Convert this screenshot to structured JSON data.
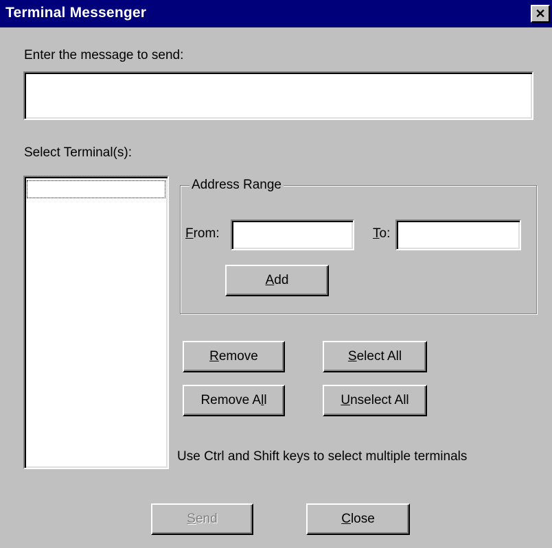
{
  "window": {
    "title": "Terminal Messenger",
    "close_glyph": "✕"
  },
  "message": {
    "label": "Enter the message to send:",
    "value": ""
  },
  "terminals": {
    "label": "Select Terminal(s):",
    "items": []
  },
  "address_range": {
    "legend": "Address Range",
    "from": {
      "accel": "F",
      "rest": "rom:",
      "value": ""
    },
    "to": {
      "accel": "T",
      "rest": "o:",
      "value": ""
    },
    "add": {
      "accel": "A",
      "rest": "dd"
    }
  },
  "buttons": {
    "remove": {
      "accel": "R",
      "rest": "emove"
    },
    "remove_all": {
      "pre": "Remove A",
      "accel": "l",
      "rest": "l"
    },
    "select_all": {
      "accel": "S",
      "rest": "elect All"
    },
    "unselect_all": {
      "accel": "U",
      "rest": "nselect All"
    },
    "send": {
      "accel": "S",
      "rest": "end",
      "enabled": false
    },
    "close": {
      "accel": "C",
      "rest": "lose"
    }
  },
  "hint": "Use Ctrl and Shift keys to select multiple terminals"
}
